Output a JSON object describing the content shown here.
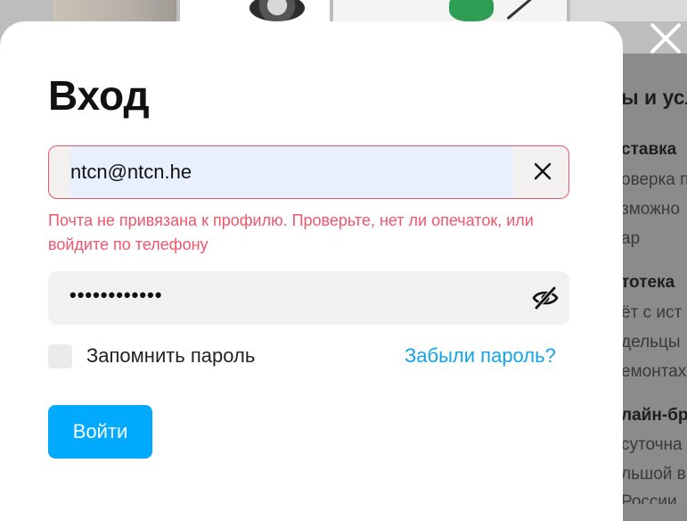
{
  "background": {
    "side_lines": [
      {
        "text": "ы и усл",
        "style": "big"
      },
      {
        "text": "ставка",
        "style": "bold"
      },
      {
        "text": "оверка п",
        "style": "normal"
      },
      {
        "text": "зможно",
        "style": "normal"
      },
      {
        "text": "ар",
        "style": "normal"
      },
      {
        "text": "тотека",
        "style": "bold"
      },
      {
        "text": "ёт с ист",
        "style": "normal"
      },
      {
        "text": "дельцы",
        "style": "normal"
      },
      {
        "text": "емонтах",
        "style": "normal"
      },
      {
        "text": "лайн-бр",
        "style": "bold"
      },
      {
        "text": "суточна",
        "style": "normal"
      },
      {
        "text": "льшой в",
        "style": "normal"
      },
      {
        "text": "России",
        "style": "normal"
      }
    ]
  },
  "modal": {
    "title": "Вход",
    "email": {
      "value": "ntcn@ntcn.he",
      "error": "Почта не привязана к профилю. Проверьте, нет ли опечаток, или войдите по телефону"
    },
    "password": {
      "masked_value": "••••••••••••",
      "visibility_icon": "eye-off-icon"
    },
    "remember_label": "Запомнить пароль",
    "forgot_link": "Забыли пароль?",
    "submit_label": "Войти"
  },
  "colors": {
    "error": "#f0566a",
    "link": "#13a4e6",
    "primary": "#00aaff",
    "autofill": "#e8f0fe"
  }
}
